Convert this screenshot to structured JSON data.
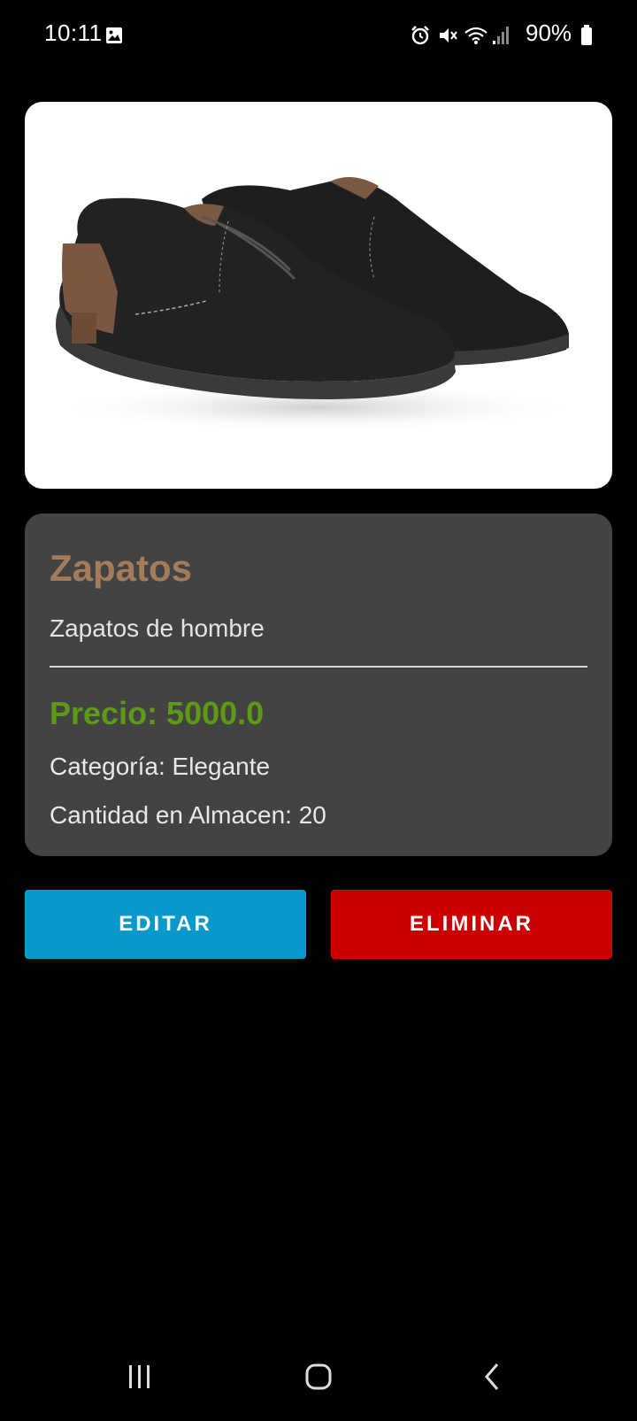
{
  "status_bar": {
    "time": "10:11",
    "battery": "90%",
    "icons": [
      "gallery-icon",
      "alarm-icon",
      "mute-icon",
      "wifi-icon",
      "signal-icon",
      "battery-icon"
    ]
  },
  "product": {
    "image_icon": "shoe-image",
    "title": "Zapatos",
    "description": "Zapatos de hombre",
    "price": "Precio: 5000.0",
    "category": "Categoría: Elegante",
    "stock": "Cantidad en Almacen: 20"
  },
  "actions": {
    "edit_label": "EDITAR",
    "delete_label": "ELIMINAR"
  },
  "nav": {
    "icons": [
      "recent-apps-icon",
      "home-icon",
      "back-icon"
    ]
  },
  "colors": {
    "background": "#000000",
    "card": "#434343",
    "title": "#a57c5a",
    "price": "#5d9b12",
    "edit": "#0899cc",
    "delete": "#cc0000"
  }
}
